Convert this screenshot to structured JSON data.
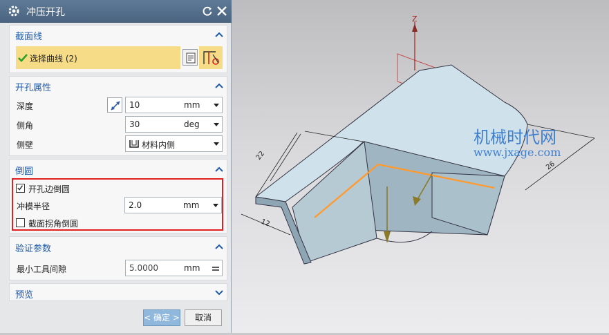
{
  "dialog": {
    "title": "冲压开孔",
    "icons": {
      "title_icon": "gear-icon",
      "reset": "reset-icon",
      "close": "close-icon"
    }
  },
  "section_curve": {
    "header": "截面线",
    "select_curve_label": "选择曲线 (2)"
  },
  "hole_props": {
    "header": "开孔属性",
    "depth_label": "深度",
    "depth_value": "10",
    "depth_unit": "mm",
    "side_angle_label": "侧角",
    "side_angle_value": "30",
    "side_angle_unit": "deg",
    "side_wall_label": "侧壁",
    "side_wall_value": "材料内侧"
  },
  "fillet": {
    "header": "倒圆",
    "hole_edge_label": "开孔边倒圆",
    "hole_edge_checked": true,
    "punch_radius_label": "冲模半径",
    "punch_radius_value": "2.0",
    "punch_radius_unit": "mm",
    "corner_label": "截面拐角倒圆",
    "corner_checked": false
  },
  "verify": {
    "header": "验证参数",
    "min_tool_label": "最小工具间隙",
    "min_tool_value": "5.0000",
    "min_tool_unit": "mm"
  },
  "preview": {
    "header": "预览"
  },
  "buttons": {
    "ok": "< 确定 >",
    "cancel": "取消"
  },
  "viewport": {
    "axis_label": "Z",
    "dim_22": "22",
    "dim_12": "12",
    "dim_26": "26",
    "watermark_line1": "机械时代网",
    "watermark_line2": "www.jxage.com"
  },
  "colors": {
    "title_bar": "#4f6a86",
    "section_header": "#1e5aa8",
    "selection_highlight": "#f7dc87",
    "callout_border": "#e02020",
    "ok_button": "#8fb8dc",
    "edge_highlight": "#ff9a30",
    "watermark": "#3f7fd0"
  }
}
